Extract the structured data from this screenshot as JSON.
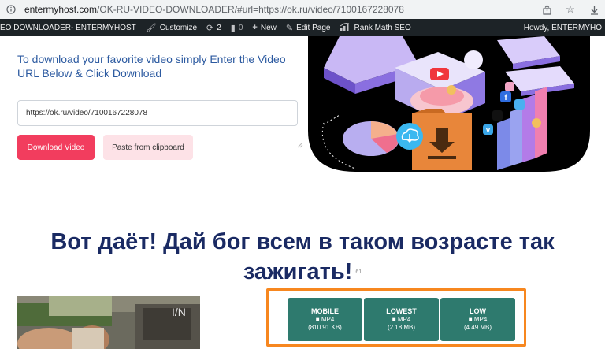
{
  "browser": {
    "url_domain": "entermyhost.com",
    "url_path": "/OK-RU-VIDEO-DOWNLOADER/#url=https://ok.ru/video/7100167228078"
  },
  "adminbar": {
    "site_name": "EO DOWNLOADER- ENTERMYHOST",
    "customize": "Customize",
    "updates_count": "2",
    "comments_count": "0",
    "new": "New",
    "edit_page": "Edit Page",
    "rank_math": "Rank Math SEO",
    "howdy": "Howdy, ENTERMYHO"
  },
  "intro": {
    "text": "To download your favorite video simply Enter the Video URL Below & Click Download"
  },
  "form": {
    "url_value": "https://ok.ru/video/7100167228078",
    "download_label": "Download Video",
    "paste_label": "Paste from clipboard"
  },
  "video": {
    "title": "Вот даёт! Дай бог всем в таком возрасте так зажигать!",
    "count": "61"
  },
  "formats": [
    {
      "quality": "MOBILE",
      "type": "MP4",
      "size": "(810.91 KB)"
    },
    {
      "quality": "LOWEST",
      "type": "MP4",
      "size": "(2.18 MB)"
    },
    {
      "quality": "LOW",
      "type": "MP4",
      "size": "(4.49 MB)"
    }
  ],
  "colors": {
    "accent_red": "#f23d5e",
    "paste_bg": "#fde2e7",
    "format_green": "#2e7a6e",
    "format_border": "#f7871f",
    "title_navy": "#1a2a63",
    "intro_blue": "#2c5aa0"
  }
}
